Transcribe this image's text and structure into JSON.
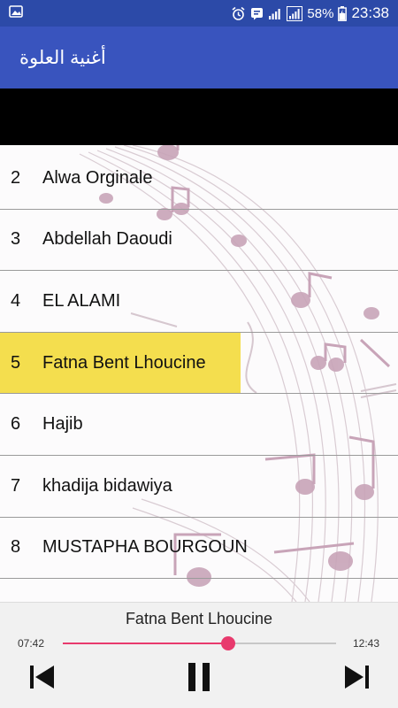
{
  "status_bar": {
    "battery_percent": "58%",
    "time": "23:38",
    "icons": [
      "gallery-icon",
      "alarm-icon",
      "message-icon",
      "signal-icon",
      "signal-icon",
      "battery-icon"
    ]
  },
  "app_bar": {
    "title": "أغنية العلوة"
  },
  "songs": [
    {
      "number": "2",
      "title": "Alwa Orginale",
      "active": false
    },
    {
      "number": "3",
      "title": "Abdellah Daoudi",
      "active": false
    },
    {
      "number": "4",
      "title": "EL ALAMI",
      "active": false
    },
    {
      "number": "5",
      "title": "Fatna Bent Lhoucine",
      "active": true
    },
    {
      "number": "6",
      "title": "Hajib",
      "active": false
    },
    {
      "number": "7",
      "title": "khadija bidawiya",
      "active": false
    },
    {
      "number": "8",
      "title": "MUSTAPHA BOURGOUN",
      "active": false
    }
  ],
  "player": {
    "now_playing": "Fatna Bent Lhoucine",
    "current_time": "07:42",
    "total_time": "12:43",
    "progress": 0.605,
    "controls": [
      "skip-previous-icon",
      "pause-icon",
      "skip-next-icon"
    ]
  },
  "colors": {
    "status_bar": "#2c4aa8",
    "app_bar": "#3954be",
    "highlight": "#f4de4e",
    "accent": "#e83a6d"
  }
}
